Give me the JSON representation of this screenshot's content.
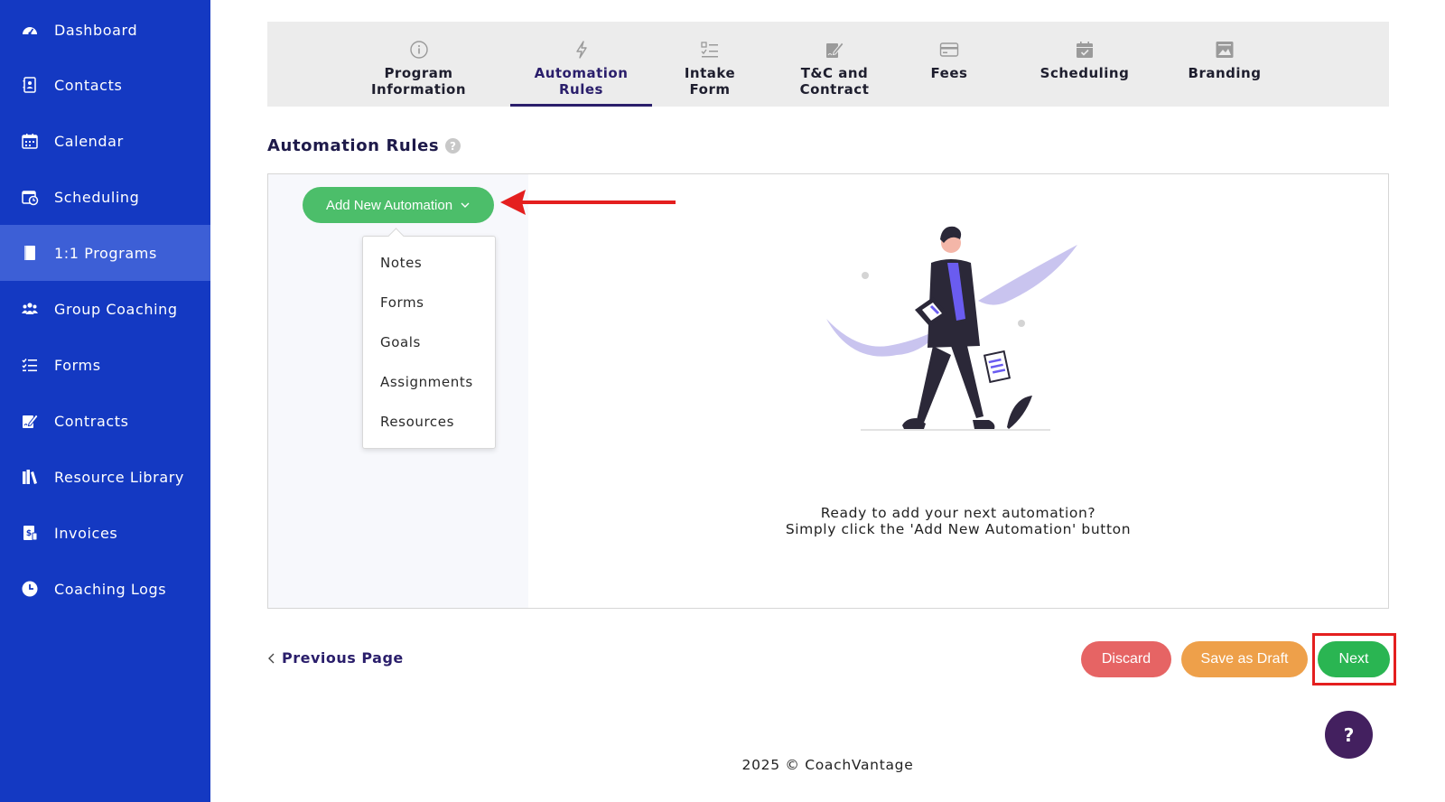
{
  "sidebar": {
    "items": [
      {
        "label": "Dashboard",
        "icon": "dashboard-gauge-icon"
      },
      {
        "label": "Contacts",
        "icon": "contacts-book-icon"
      },
      {
        "label": "Calendar",
        "icon": "calendar-icon"
      },
      {
        "label": "Scheduling",
        "icon": "calendar-clock-icon"
      },
      {
        "label": "1:1 Programs",
        "icon": "book-icon",
        "active": true
      },
      {
        "label": "Group Coaching",
        "icon": "users-group-icon"
      },
      {
        "label": "Forms",
        "icon": "checklist-icon"
      },
      {
        "label": "Contracts",
        "icon": "signature-icon"
      },
      {
        "label": "Resource Library",
        "icon": "library-icon"
      },
      {
        "label": "Invoices",
        "icon": "invoice-icon"
      },
      {
        "label": "Coaching Logs",
        "icon": "clock-icon"
      }
    ]
  },
  "tabs": [
    {
      "label": "Program\nInformation",
      "icon": "info-icon"
    },
    {
      "label": "Automation\nRules",
      "icon": "bolt-icon",
      "active": true
    },
    {
      "label": "Intake\nForm",
      "icon": "checklist-icon"
    },
    {
      "label": "T&C and\nContract",
      "icon": "signature-icon"
    },
    {
      "label": "Fees",
      "icon": "credit-card-icon"
    },
    {
      "label": "Scheduling",
      "icon": "calendar-check-icon"
    },
    {
      "label": "Branding",
      "icon": "image-icon"
    }
  ],
  "section": {
    "title": "Automation Rules",
    "help": "?"
  },
  "automation": {
    "add_button_label": "Add New Automation",
    "dropdown_items": [
      "Notes",
      "Forms",
      "Goals",
      "Assignments",
      "Resources"
    ],
    "empty_line1": "Ready to add your next automation?",
    "empty_line2": "Simply click the 'Add New Automation' button"
  },
  "actions": {
    "previous_label": "Previous Page",
    "discard_label": "Discard",
    "draft_label": "Save as Draft",
    "next_label": "Next",
    "help_label": "?"
  },
  "footer": {
    "copyright": "2025 © CoachVantage"
  },
  "colors": {
    "sidebar": "#1439c2",
    "sidebar_active": "#3d5fd6",
    "accent_green": "#4cbe6a",
    "discard": "#e66464",
    "draft": "#eea04a",
    "next": "#2ab552",
    "annotation_red": "#e41f1f",
    "help_fab": "#43205f"
  }
}
